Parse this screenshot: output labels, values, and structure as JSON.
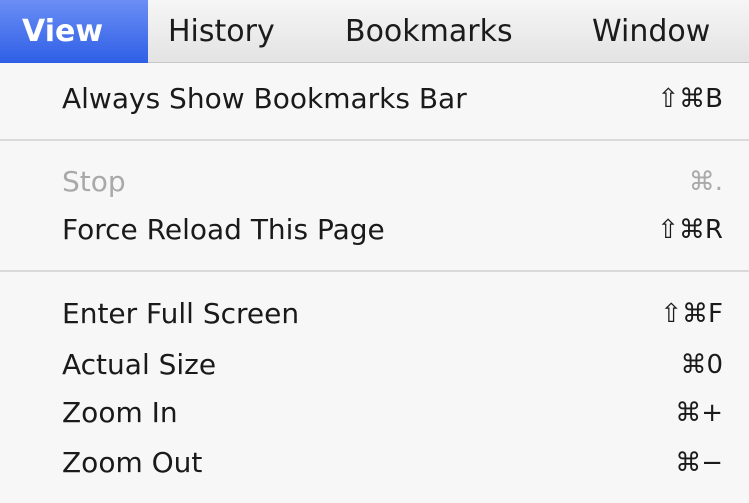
{
  "menubar": {
    "items": [
      {
        "label": "View",
        "selected": true
      },
      {
        "label": "History"
      },
      {
        "label": "Bookmarks"
      },
      {
        "label": "Window"
      }
    ]
  },
  "dropdown": {
    "items": [
      {
        "label": "Always Show Bookmarks Bar",
        "shortcut": "⇧⌘B",
        "enabled": true
      },
      {
        "label": "Stop",
        "shortcut": "⌘.",
        "enabled": false
      },
      {
        "label": "Force Reload This Page",
        "shortcut": "⇧⌘R",
        "enabled": true
      },
      {
        "label": "Enter Full Screen",
        "shortcut": "⇧⌘F",
        "enabled": true
      },
      {
        "label": "Actual Size",
        "shortcut": "⌘0",
        "enabled": true
      },
      {
        "label": "Zoom In",
        "shortcut": "⌘+",
        "enabled": true
      },
      {
        "label": "Zoom Out",
        "shortcut": "⌘−",
        "enabled": true
      }
    ]
  },
  "background": {
    "line1": "",
    "line2": "",
    "line3": "",
    "line4": ""
  }
}
